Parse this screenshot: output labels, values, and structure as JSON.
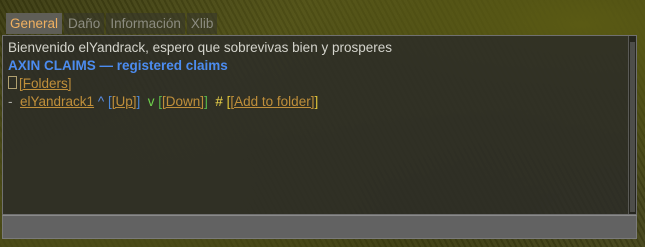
{
  "tabs": [
    {
      "label": "General"
    },
    {
      "label": "Daño"
    },
    {
      "label": "Información"
    },
    {
      "label": "Xlib"
    }
  ],
  "chat": {
    "welcome": "Bienvenido elYandrack, espero que sobrevivas bien y prosperes",
    "header": "AXIN CLAIMS — registered claims",
    "folders_link": "[Folders]",
    "claim": {
      "dash": "-",
      "name": "elYandrack1",
      "up_symbol": "^",
      "up_open": "[",
      "up_link": "[Up]",
      "up_close": "]",
      "down_symbol": "v",
      "down_open": "[",
      "down_link": "[Down]",
      "down_close": "]",
      "add_symbol": "#",
      "add_open": "[",
      "add_link": "[Add to folder]",
      "add_close": "]"
    }
  },
  "colors": {
    "active_tab_text": "#f0b060",
    "header_blue": "#4c8cf0",
    "link_orange": "#c08f3a",
    "green": "#6fd24c",
    "yellow": "#efd64a"
  },
  "icons": {
    "folder_glyph": "box-glyph"
  }
}
